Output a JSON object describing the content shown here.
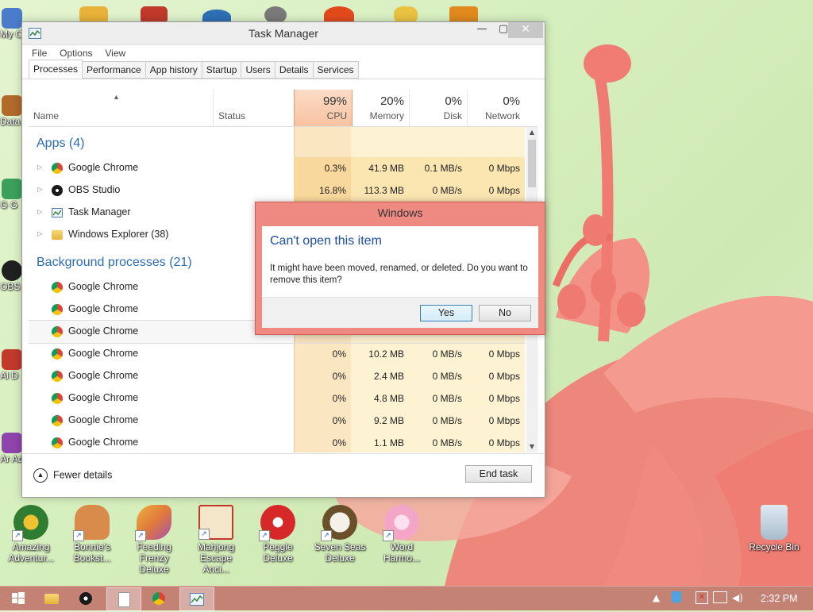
{
  "desktop": {
    "left_icons": [
      {
        "label": "My C",
        "icon": "computer-icon",
        "color": "#4a7cc9"
      },
      {
        "label": "Data",
        "icon": "data-icon",
        "color": "#b06a2a"
      },
      {
        "label": "G G",
        "icon": "game-icon",
        "color": "#3aa05a"
      },
      {
        "label": "OBS",
        "icon": "obs-icon",
        "color": "#202020"
      },
      {
        "label": "Al D",
        "icon": "game-icon",
        "color": "#c0392b"
      },
      {
        "label": "Ar Adv",
        "icon": "game-icon",
        "color": "#8e44ad"
      }
    ],
    "bottom_icons": [
      {
        "label": "Amazing Adventur...",
        "icon": "compass-icon",
        "color": "#2e7d32"
      },
      {
        "label": "Bonnie's Bookst...",
        "icon": "bonnie-icon",
        "color": "#d98b4c"
      },
      {
        "label": "Feeding Frenzy Deluxe",
        "icon": "fish-icon",
        "color": "#e07a3c"
      },
      {
        "label": "Mahjong Escape Anci...",
        "icon": "mahjong-icon",
        "color": "#c0392b"
      },
      {
        "label": "Peggle Deluxe",
        "icon": "peggle-icon",
        "color": "#d62828"
      },
      {
        "label": "Seven Seas Deluxe",
        "icon": "skull-icon",
        "color": "#6b4f2a"
      },
      {
        "label": "Word Harmo...",
        "icon": "flower-icon",
        "color": "#f3a6c8"
      }
    ],
    "recycle_bin": {
      "label": "Recycle Bin",
      "icon": "recycle-bin-icon"
    }
  },
  "task_manager": {
    "title": "Task Manager",
    "menu": [
      "File",
      "Options",
      "View"
    ],
    "tabs": [
      "Processes",
      "Performance",
      "App history",
      "Startup",
      "Users",
      "Details",
      "Services"
    ],
    "active_tab": "Processes",
    "columns": {
      "name": "Name",
      "status": "Status",
      "cpu": {
        "pct": "99%",
        "label": "CPU"
      },
      "memory": {
        "pct": "20%",
        "label": "Memory"
      },
      "disk": {
        "pct": "0%",
        "label": "Disk"
      },
      "network": {
        "pct": "0%",
        "label": "Network"
      }
    },
    "groups": {
      "apps": "Apps (4)",
      "background": "Background processes (21)"
    },
    "apps": [
      {
        "name": "Google Chrome",
        "icon": "chrome-icon",
        "cpu": "0.3%",
        "mem": "41.9 MB",
        "disk": "0.1 MB/s",
        "net": "0 Mbps"
      },
      {
        "name": "OBS Studio",
        "icon": "obs-icon",
        "cpu": "16.8%",
        "mem": "113.3 MB",
        "disk": "0 MB/s",
        "net": "0 Mbps"
      },
      {
        "name": "Task Manager",
        "icon": "task-manager-icon",
        "cpu": "",
        "mem": "",
        "disk": "",
        "net": ""
      },
      {
        "name": "Windows Explorer (38)",
        "icon": "folder-icon",
        "cpu": "",
        "mem": "",
        "disk": "",
        "net": ""
      }
    ],
    "background": [
      {
        "name": "Google Chrome",
        "cpu": "",
        "mem": "",
        "disk": "",
        "net": ""
      },
      {
        "name": "Google Chrome",
        "cpu": "",
        "mem": "",
        "disk": "",
        "net": ""
      },
      {
        "name": "Google Chrome",
        "cpu": "",
        "mem": "",
        "disk": "",
        "net": ""
      },
      {
        "name": "Google Chrome",
        "cpu": "0%",
        "mem": "10.2 MB",
        "disk": "0 MB/s",
        "net": "0 Mbps"
      },
      {
        "name": "Google Chrome",
        "cpu": "0%",
        "mem": "2.4 MB",
        "disk": "0 MB/s",
        "net": "0 Mbps"
      },
      {
        "name": "Google Chrome",
        "cpu": "0%",
        "mem": "4.8 MB",
        "disk": "0 MB/s",
        "net": "0 Mbps"
      },
      {
        "name": "Google Chrome",
        "cpu": "0%",
        "mem": "9.2 MB",
        "disk": "0 MB/s",
        "net": "0 Mbps"
      },
      {
        "name": "Google Chrome",
        "cpu": "0%",
        "mem": "1.1 MB",
        "disk": "0 MB/s",
        "net": "0 Mbps"
      }
    ],
    "fewer_details": "Fewer details",
    "end_task": "End task"
  },
  "dialog": {
    "title": "Windows",
    "heading": "Can't open this item",
    "message": "It might have been moved, renamed, or deleted. Do you want to remove this item?",
    "yes": "Yes",
    "no": "No"
  },
  "taskbar": {
    "clock": "2:32 PM",
    "accent": "#c48275"
  }
}
